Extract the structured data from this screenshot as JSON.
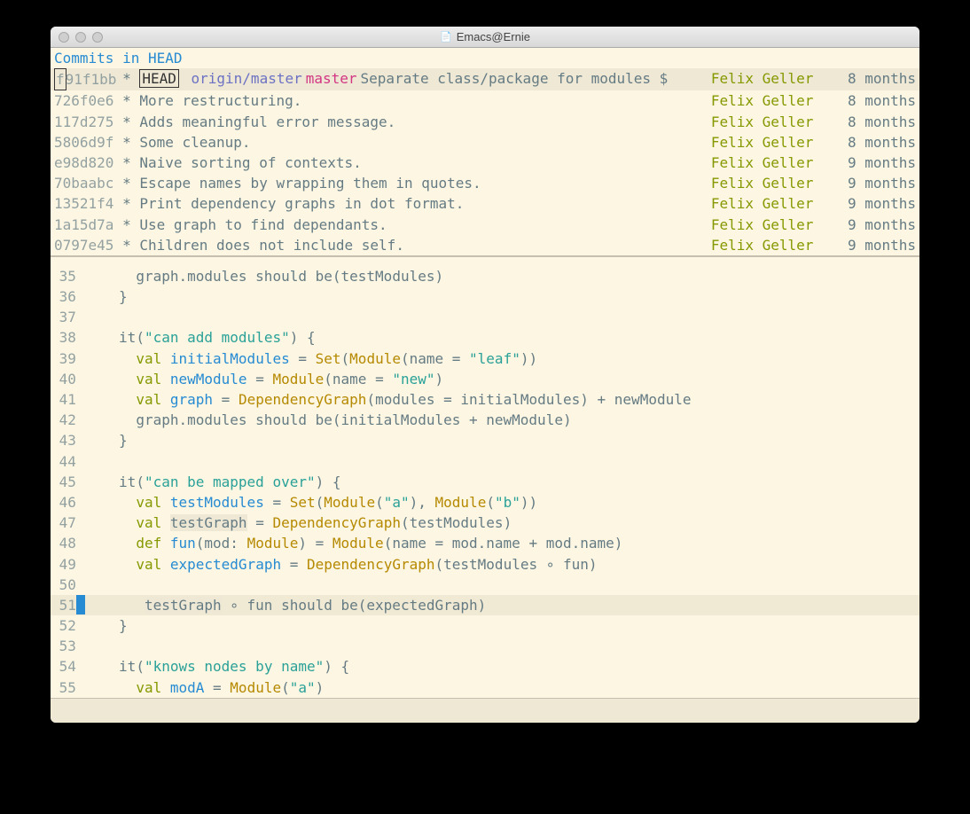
{
  "window": {
    "title": "Emacs@Ernie"
  },
  "commits_header": "Commits in HEAD",
  "commits": [
    {
      "hash": "f91f1bb",
      "first_char": "f",
      "rest": "91f1bb",
      "head": "HEAD",
      "remote": "origin/master",
      "local": "master",
      "msg": "Separate class/package for modules $",
      "author": "Felix Geller",
      "age": "8 months",
      "highlight": true
    },
    {
      "hash": "726f0e6",
      "msg": "More restructuring.",
      "author": "Felix Geller",
      "age": "8 months"
    },
    {
      "hash": "117d275",
      "msg": "Adds meaningful error message.",
      "author": "Felix Geller",
      "age": "8 months"
    },
    {
      "hash": "5806d9f",
      "msg": "Some cleanup.",
      "author": "Felix Geller",
      "age": "8 months"
    },
    {
      "hash": "e98d820",
      "msg": "Naive sorting of contexts.",
      "author": "Felix Geller",
      "age": "9 months"
    },
    {
      "hash": "70baabc",
      "msg": "Escape names by wrapping them in quotes.",
      "author": "Felix Geller",
      "age": "9 months"
    },
    {
      "hash": "13521f4",
      "msg": "Print dependency graphs in dot format.",
      "author": "Felix Geller",
      "age": "9 months"
    },
    {
      "hash": "1a15d7a",
      "msg": "Use graph to find dependants.",
      "author": "Felix Geller",
      "age": "9 months"
    },
    {
      "hash": "0797e45",
      "msg": "Children does not include self.",
      "author": "Felix Geller",
      "age": "9 months"
    }
  ],
  "code": [
    {
      "n": "35",
      "tokens": [
        [
          "pn",
          "      graph.modules should be"
        ],
        [
          "pn",
          "("
        ],
        [
          "id",
          "testModules"
        ],
        [
          "pn",
          ")"
        ]
      ]
    },
    {
      "n": "36",
      "tokens": [
        [
          "pn",
          "    }"
        ]
      ]
    },
    {
      "n": "37",
      "tokens": []
    },
    {
      "n": "38",
      "tokens": [
        [
          "pn",
          "    it("
        ],
        [
          "str",
          "\"can add modules\""
        ],
        [
          "pn",
          ") {"
        ]
      ]
    },
    {
      "n": "39",
      "tokens": [
        [
          "pn",
          "      "
        ],
        [
          "kw",
          "val"
        ],
        [
          "pn",
          " "
        ],
        [
          "fn",
          "initialModules"
        ],
        [
          "pn",
          " = "
        ],
        [
          "ty",
          "Set"
        ],
        [
          "pn",
          "("
        ],
        [
          "ty",
          "Module"
        ],
        [
          "pn",
          "(name = "
        ],
        [
          "str",
          "\"leaf\""
        ],
        [
          "pn",
          "))"
        ]
      ]
    },
    {
      "n": "40",
      "tokens": [
        [
          "pn",
          "      "
        ],
        [
          "kw",
          "val"
        ],
        [
          "pn",
          " "
        ],
        [
          "fn",
          "newModule"
        ],
        [
          "pn",
          " = "
        ],
        [
          "ty",
          "Module"
        ],
        [
          "pn",
          "(name = "
        ],
        [
          "str",
          "\"new\""
        ],
        [
          "pn",
          ")"
        ]
      ]
    },
    {
      "n": "41",
      "tokens": [
        [
          "pn",
          "      "
        ],
        [
          "kw",
          "val"
        ],
        [
          "pn",
          " "
        ],
        [
          "fn",
          "graph"
        ],
        [
          "pn",
          " = "
        ],
        [
          "ty",
          "DependencyGraph"
        ],
        [
          "pn",
          "(modules = initialModules) + newModule"
        ]
      ]
    },
    {
      "n": "42",
      "tokens": [
        [
          "pn",
          "      graph.modules should be(initialModules + newModule)"
        ]
      ]
    },
    {
      "n": "43",
      "tokens": [
        [
          "pn",
          "    }"
        ]
      ]
    },
    {
      "n": "44",
      "tokens": []
    },
    {
      "n": "45",
      "tokens": [
        [
          "pn",
          "    it("
        ],
        [
          "str",
          "\"can be mapped over\""
        ],
        [
          "pn",
          ") {"
        ]
      ]
    },
    {
      "n": "46",
      "tokens": [
        [
          "pn",
          "      "
        ],
        [
          "kw",
          "val"
        ],
        [
          "pn",
          " "
        ],
        [
          "fn",
          "testModules"
        ],
        [
          "pn",
          " = "
        ],
        [
          "ty",
          "Set"
        ],
        [
          "pn",
          "("
        ],
        [
          "ty",
          "Module"
        ],
        [
          "pn",
          "("
        ],
        [
          "str",
          "\"a\""
        ],
        [
          "pn",
          "), "
        ],
        [
          "ty",
          "Module"
        ],
        [
          "pn",
          "("
        ],
        [
          "str",
          "\"b\""
        ],
        [
          "pn",
          "))"
        ]
      ]
    },
    {
      "n": "47",
      "tokens": [
        [
          "pn",
          "      "
        ],
        [
          "kw",
          "val"
        ],
        [
          "pn",
          " "
        ],
        [
          "hl-sym",
          "testGraph"
        ],
        [
          "pn",
          " = "
        ],
        [
          "ty",
          "DependencyGraph"
        ],
        [
          "pn",
          "(testModules)"
        ]
      ]
    },
    {
      "n": "48",
      "tokens": [
        [
          "pn",
          "      "
        ],
        [
          "kw",
          "def"
        ],
        [
          "pn",
          " "
        ],
        [
          "fn",
          "fun"
        ],
        [
          "pn",
          "(mod"
        ],
        [
          "pn",
          ": "
        ],
        [
          "ty",
          "Module"
        ],
        [
          "pn",
          ") = "
        ],
        [
          "ty",
          "Module"
        ],
        [
          "pn",
          "(name = mod.name + mod.name)"
        ]
      ]
    },
    {
      "n": "49",
      "tokens": [
        [
          "pn",
          "      "
        ],
        [
          "kw",
          "val"
        ],
        [
          "pn",
          " "
        ],
        [
          "fn",
          "expectedGraph"
        ],
        [
          "pn",
          " = "
        ],
        [
          "ty",
          "DependencyGraph"
        ],
        [
          "pn",
          "(testModules ∘ fun)"
        ]
      ]
    },
    {
      "n": "50",
      "tokens": []
    },
    {
      "n": "51",
      "hl": true,
      "cursor": true,
      "tokens": [
        [
          "pn",
          "      "
        ],
        [
          "hl-sym",
          "testGraph"
        ],
        [
          "pn",
          " ∘ fun should be"
        ],
        [
          "pn",
          "("
        ],
        [
          "id",
          "expectedGraph"
        ],
        [
          "pn",
          ")"
        ]
      ]
    },
    {
      "n": "52",
      "tokens": [
        [
          "pn",
          "    }"
        ]
      ]
    },
    {
      "n": "53",
      "tokens": []
    },
    {
      "n": "54",
      "tokens": [
        [
          "pn",
          "    it("
        ],
        [
          "str",
          "\"knows nodes by name\""
        ],
        [
          "pn",
          ") {"
        ]
      ]
    },
    {
      "n": "55",
      "tokens": [
        [
          "pn",
          "      "
        ],
        [
          "kw",
          "val"
        ],
        [
          "pn",
          " "
        ],
        [
          "fn",
          "modA"
        ],
        [
          "pn",
          " = "
        ],
        [
          "ty",
          "Module"
        ],
        [
          "pn",
          "("
        ],
        [
          "str",
          "\"a\""
        ],
        [
          "pn",
          ")"
        ]
      ]
    }
  ]
}
